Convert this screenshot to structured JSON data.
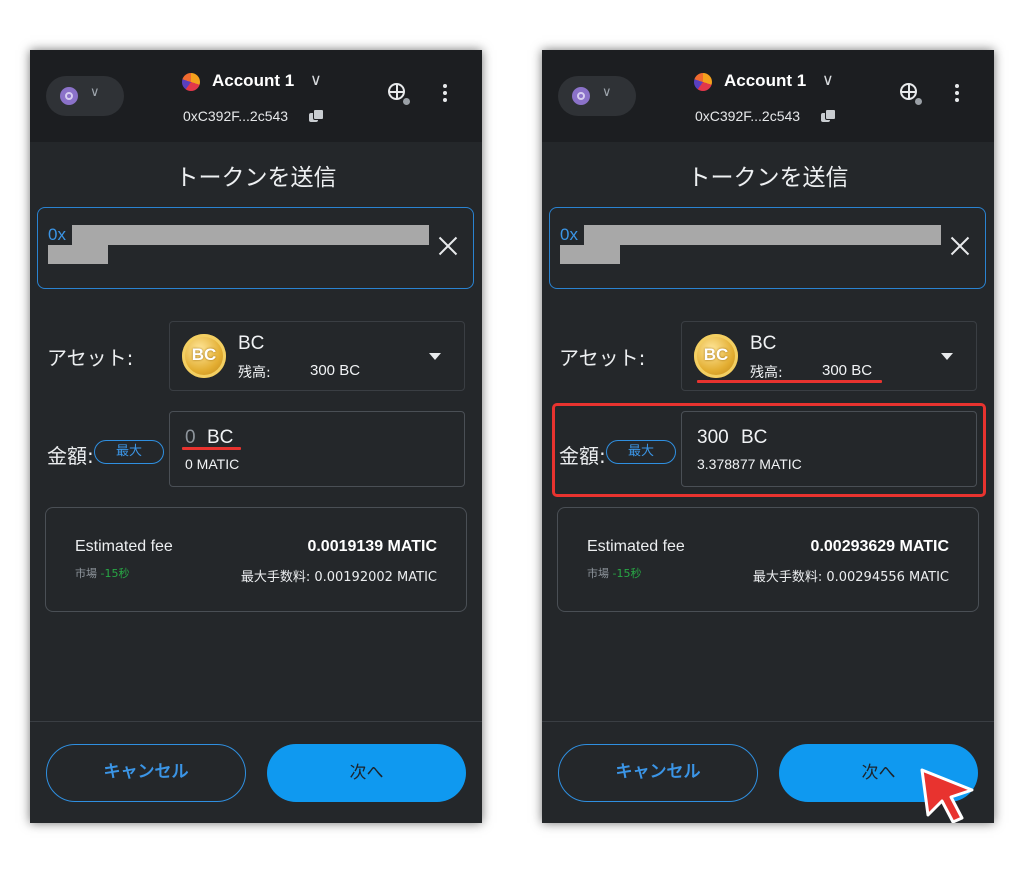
{
  "panels": [
    {
      "account_name": "Account 1",
      "account_address": "0xC392F...2c543",
      "title": "トークンを送信",
      "recipient_prefix": "0x",
      "asset_label": "アセット:",
      "asset_symbol": "BC",
      "coin_glyph": "BC",
      "balance_label": "残高:",
      "balance_value": "300 BC",
      "amount_label": "金額:",
      "max_label": "最大",
      "amount_value": "0",
      "amount_unit": "BC",
      "amount_fiat": "0 MATIC",
      "fee_label": "Estimated fee",
      "fee_value": "0.0019139 MATIC",
      "fee_market": "市場",
      "fee_time": "-15秒",
      "fee_max": "最大手数料: 0.00192002 MATIC",
      "cancel_label": "キャンセル",
      "next_label": "次へ"
    },
    {
      "account_name": "Account 1",
      "account_address": "0xC392F...2c543",
      "title": "トークンを送信",
      "recipient_prefix": "0x",
      "asset_label": "アセット:",
      "asset_symbol": "BC",
      "coin_glyph": "BC",
      "balance_label": "残高:",
      "balance_value": "300 BC",
      "amount_label": "金額:",
      "max_label": "最大",
      "amount_value": "300",
      "amount_unit": "BC",
      "amount_fiat": "3.378877 MATIC",
      "fee_label": "Estimated fee",
      "fee_value": "0.00293629 MATIC",
      "fee_market": "市場",
      "fee_time": "-15秒",
      "fee_max": "最大手数料: 0.00294556 MATIC",
      "cancel_label": "キャンセル",
      "next_label": "次へ"
    }
  ],
  "colors": {
    "accent_blue": "#0f99f0",
    "highlight_red": "#e8332f",
    "panel_bg": "#24272a"
  }
}
